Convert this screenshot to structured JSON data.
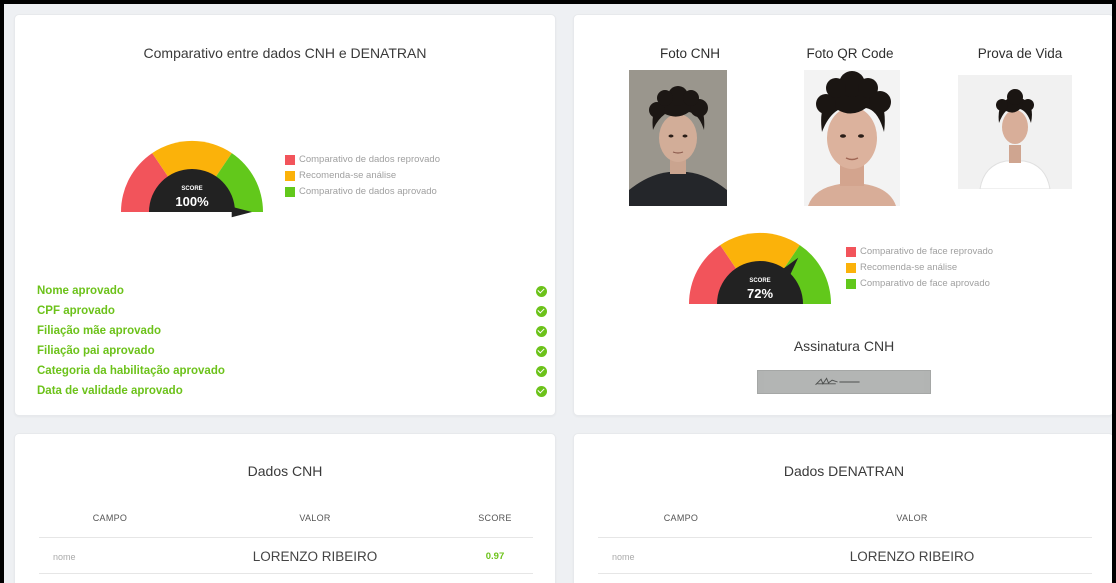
{
  "comparison_card": {
    "title": "Comparativo entre dados CNH e DENATRAN",
    "gauge": {
      "score_label": "SCORE",
      "score_text": "100%",
      "value": 1.0
    },
    "legend": [
      {
        "label": "Comparativo de dados reprovado",
        "color": "#f2545b"
      },
      {
        "label": "Recomenda-se análise",
        "color": "#fbb20a"
      },
      {
        "label": "Comparativo de dados aprovado",
        "color": "#62c81b"
      }
    ],
    "checks": [
      {
        "label": "Nome aprovado"
      },
      {
        "label": "CPF aprovado"
      },
      {
        "label": "Filiação mãe aprovado"
      },
      {
        "label": "Filiação pai aprovado"
      },
      {
        "label": "Categoria da habilitação aprovado"
      },
      {
        "label": "Data de validade aprovado"
      }
    ]
  },
  "face_card": {
    "photos": [
      {
        "label": "Foto CNH"
      },
      {
        "label": "Foto QR Code"
      },
      {
        "label": "Prova de Vida"
      }
    ],
    "gauge": {
      "score_label": "SCORE",
      "score_text": "72%",
      "value": 0.72
    },
    "legend": [
      {
        "label": "Comparativo de face reprovado",
        "color": "#f2545b"
      },
      {
        "label": "Recomenda-se análise",
        "color": "#fbb20a"
      },
      {
        "label": "Comparativo de face aprovado",
        "color": "#62c81b"
      }
    ],
    "signature_title": "Assinatura CNH"
  },
  "cnh_table": {
    "title": "Dados CNH",
    "headers": {
      "campo": "CAMPO",
      "valor": "VALOR",
      "score": "SCORE"
    },
    "rows": [
      {
        "campo": "nome",
        "valor": "LORENZO RIBEIRO",
        "score": "0.97"
      }
    ]
  },
  "denatran_table": {
    "title": "Dados DENATRAN",
    "headers": {
      "campo": "CAMPO",
      "valor": "VALOR"
    },
    "rows": [
      {
        "campo": "nome",
        "valor": "LORENZO RIBEIRO"
      }
    ]
  },
  "colors": {
    "red": "#f2545b",
    "yellow": "#fbb20a",
    "green": "#62c81b",
    "approved_text": "#6cc21a"
  }
}
